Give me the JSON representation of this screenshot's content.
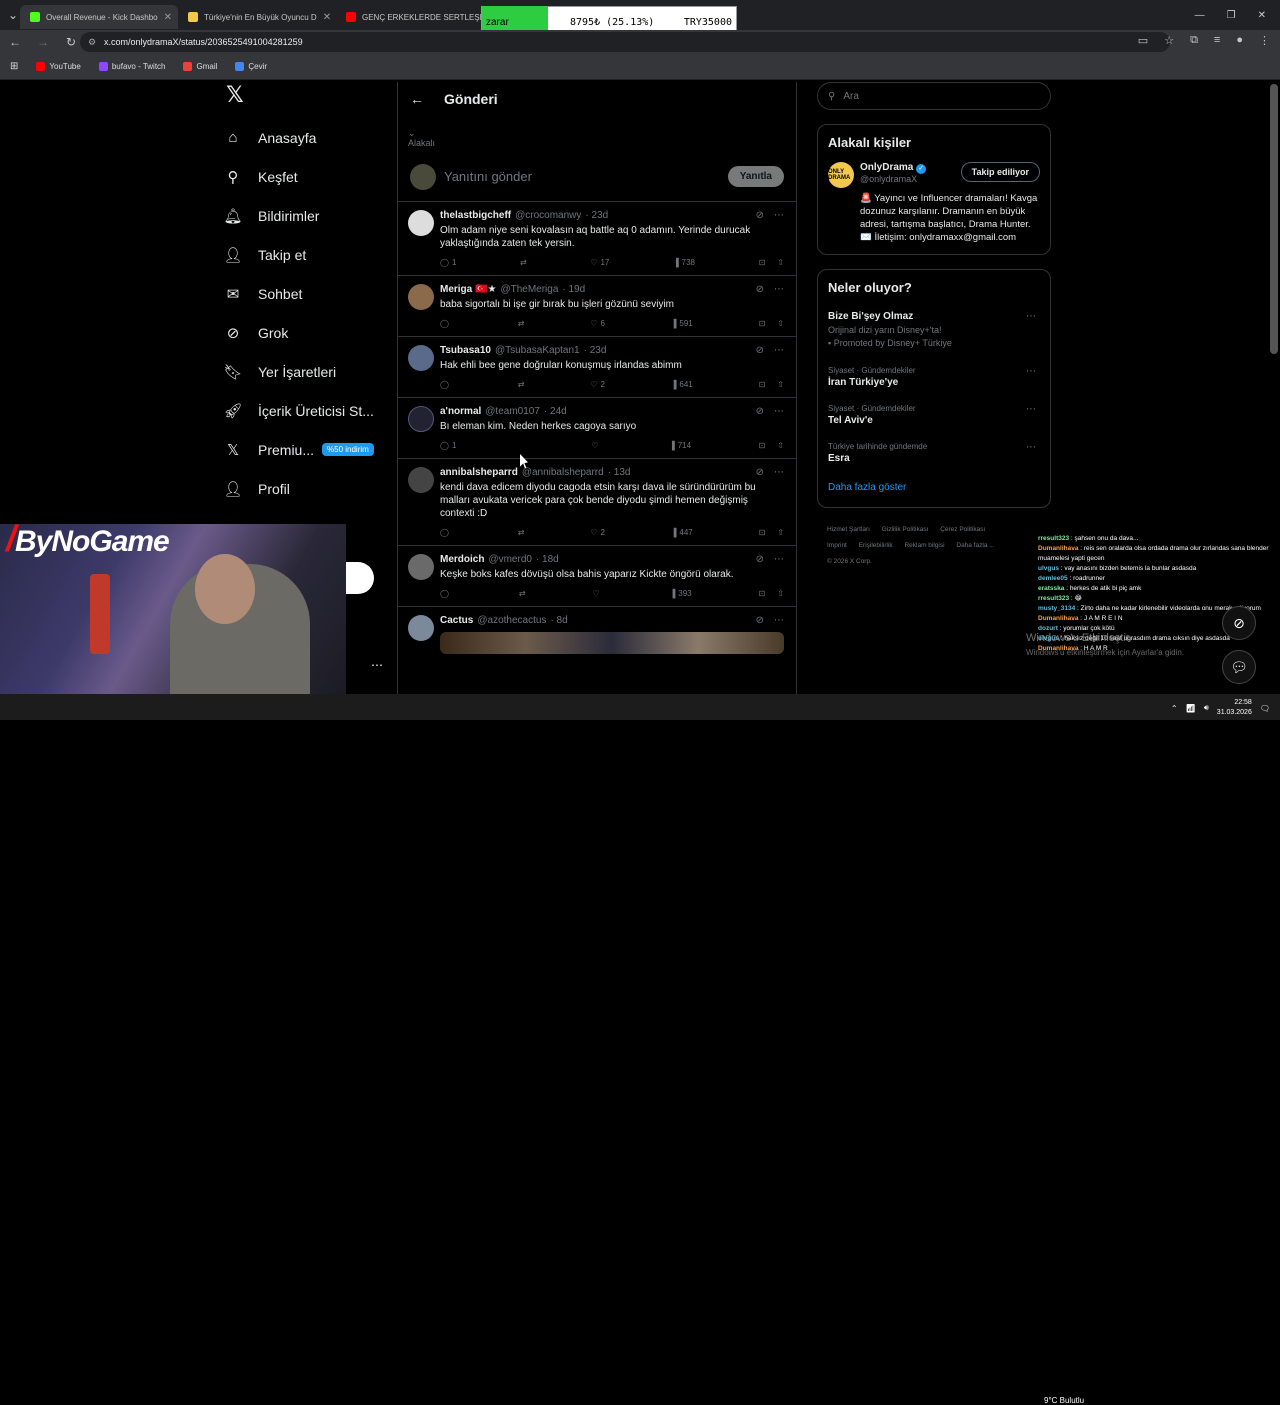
{
  "browser": {
    "tabs": [
      {
        "title": "Overall Revenue - Kick Dashbo",
        "color": "#53fc18"
      },
      {
        "title": "Türkiye'nin En Büyük Oyuncu D",
        "color": "#f2c94c"
      },
      {
        "title": "GENÇ ERKEKLERDE SERTLEŞME",
        "color": "#ff0000"
      }
    ],
    "url": "x.com/onlydramaX/status/2036525491004281259",
    "bookmarks": [
      "YouTube",
      "bufavo - Twitch",
      "Gmail",
      "Çevir"
    ]
  },
  "overlay": {
    "loss_label": "zarar",
    "progress_text": "8795₺ (25.13%)",
    "goal_text": "TRY35000"
  },
  "sidebar": {
    "items": [
      {
        "label": "Anasayfa",
        "icon": "home-icon"
      },
      {
        "label": "Keşfet",
        "icon": "search-icon"
      },
      {
        "label": "Bildirimler",
        "icon": "bell-icon"
      },
      {
        "label": "Takip et",
        "icon": "person-plus-icon"
      },
      {
        "label": "Sohbet",
        "icon": "mail-icon"
      },
      {
        "label": "Grok",
        "icon": "grok-icon"
      },
      {
        "label": "Yer İşaretleri",
        "icon": "bookmark-icon"
      },
      {
        "label": "İçerik Üreticisi St...",
        "icon": "rocket-icon"
      },
      {
        "label": "Premiu...",
        "icon": "x-icon"
      },
      {
        "label": "Profil",
        "icon": "profile-icon"
      }
    ],
    "premium_badge": "%50 indirim"
  },
  "main": {
    "header_title": "Gönderi",
    "context_label": "Alakalı",
    "reply_placeholder": "Yanıtını gönder",
    "reply_button": "Yanıtla",
    "posts": [
      {
        "name": "thelastbigcheff",
        "handle": "@crocomanwy",
        "time": "· 23d",
        "text": "Olm adam niye seni kovalasın aq battle aq 0 adamın. Yerinde durucak yaklaştığında zaten tek yersin.",
        "replies": "1",
        "likes": "17",
        "views": "738"
      },
      {
        "name": "Meriga 🇹🇷★",
        "handle": "@TheMeriga",
        "time": "· 19d",
        "text": "baba sigortalı bi işe gir bırak bu işleri gözünü seviyim",
        "replies": "",
        "likes": "6",
        "views": "591"
      },
      {
        "name": "Tsubasa10",
        "handle": "@TsubasaKaptan1",
        "time": "· 23d",
        "text": "Hak ehli bee gene doğruları konuşmuş irlandas abimm",
        "replies": "",
        "likes": "2",
        "views": "641"
      },
      {
        "name": "a'normal",
        "handle": "@team0107",
        "time": "· 24d",
        "text": "Bı eleman kim. Neden herkes cagoya sarıyo",
        "replies": "1",
        "likes": "",
        "views": "714"
      },
      {
        "name": "annibalsheparrd",
        "handle": "@annibalsheparrd",
        "time": "· 13d",
        "text": "kendi dava edicem diyodu cagoda etsin karşı dava ile süründürürüm bu malları avukata vericek para çok bende diyodu şimdi hemen değişmiş contexti :D",
        "replies": "",
        "likes": "2",
        "views": "447"
      },
      {
        "name": "Merdoich",
        "handle": "@vmerd0",
        "time": "· 18d",
        "text": "Keşke boks kafes dövüşü olsa bahis yaparız Kickte öngörü olarak.",
        "replies": "",
        "likes": "",
        "views": "393"
      },
      {
        "name": "Cactus",
        "handle": "@azothecactus",
        "time": "· 8d",
        "text": "",
        "replies": "",
        "likes": "",
        "views": ""
      }
    ]
  },
  "right": {
    "search_placeholder": "Ara",
    "related_title": "Alakalı kişiler",
    "person": {
      "name": "OnlyDrama",
      "handle": "@onlydramaX",
      "follow": "Takip ediliyor",
      "bio": "🚨 Yayıncı ve Influencer dramaları! Kavga dozunuz karşılanır. Dramanın en büyük adresi, tartışma başlatıcı, Drama Hunter. ✉️ İletişim: onlydramaxx@gmail.com",
      "avatar_text": "ONLY DRAMA"
    },
    "trends_title": "Neler oluyor?",
    "trends": [
      {
        "cat": "",
        "title": "Bize Bi'şey Olmaz",
        "sub": "Orijinal dizi yarın Disney+'ta!",
        "promo": "Promoted by Disney+ Türkiye"
      },
      {
        "cat": "Siyaset · Gündemdekiler",
        "title": "İran Türkiye'ye",
        "sub": "",
        "promo": ""
      },
      {
        "cat": "Siyaset · Gündemdekiler",
        "title": "Tel Aviv'e",
        "sub": "",
        "promo": ""
      },
      {
        "cat": "Türkiye tarihinde gündemde",
        "title": "Esra",
        "sub": "",
        "promo": ""
      }
    ],
    "show_more": "Daha fazla göster",
    "footer": [
      "Hizmet Şartları",
      "Gizlilik Politikası",
      "Çerez Politikası",
      "Imprint",
      "Erişilebilirlik",
      "Reklam bilgisi",
      "Daha fazla ...",
      "© 2026 X Corp."
    ]
  },
  "stream": {
    "brand": "ByNoGame",
    "chat": [
      {
        "user": "rresult323",
        "msg": ": şahsen onu da dava..."
      },
      {
        "user": "Dumanlihava",
        "msg": ": reis sen oralarda olsa ordada drama olur zırlandas sana blender muamelesi yapti gecen"
      },
      {
        "user": "ulvgus",
        "msg": ": vay anasını bizden betemis la bunlar asdasda"
      },
      {
        "user": "demlee05",
        "msg": ": roadrunner"
      },
      {
        "user": "eratsska",
        "msg": ": herkes de atik bi piç amk"
      },
      {
        "user": "rresult323",
        "msg": ": 😂"
      },
      {
        "user": "musty_3134",
        "msg": ": Zirto daha ne kadar kirlenebilir videolarda onu merak ediyorum"
      },
      {
        "user": "Dumanlihava",
        "msg": ": J A M R E I N"
      },
      {
        "user": "dozurt",
        "msg": ": yorumlar çok kötü"
      },
      {
        "user": "ulvgus",
        "msg": ": haksız değil 10 saat ugrasdım drama cıksın diye asdasda"
      },
      {
        "user": "Dumanlihava",
        "msg": ": H A M R"
      }
    ],
    "watermark": "Windows'u Etkinleştir",
    "watermark_sub": "Windows'u etkinleştirmek için Ayarlar'a gidin."
  },
  "taskbar": {
    "weather": "9°C  Bulutlu",
    "time": "22:58",
    "date": "31.03.2026"
  }
}
